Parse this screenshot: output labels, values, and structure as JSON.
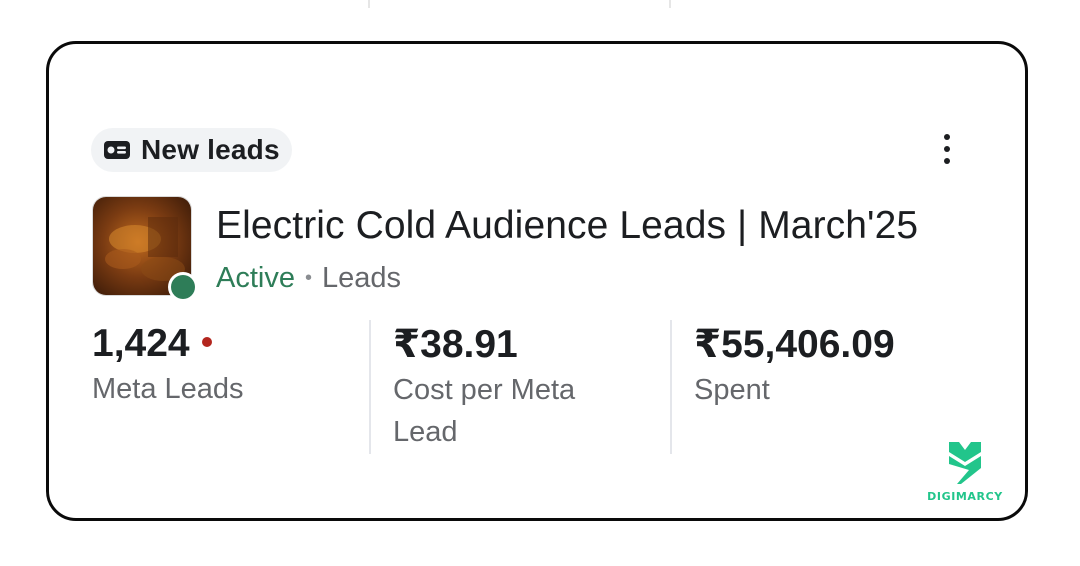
{
  "card": {
    "chip": {
      "icon": "id-card-icon",
      "label": "New leads"
    },
    "menu_icon": "more-vertical-icon",
    "campaign": {
      "title": "Electric Cold Audience Leads | March'25",
      "status": "Active",
      "separator": "•",
      "kind": "Leads",
      "status_color": "#2e7d58"
    },
    "metrics": [
      {
        "value": "1,424",
        "label": "Meta Leads",
        "alert_color": "#b3261e"
      },
      {
        "value": "₹38.91",
        "label": "Cost per Meta Lead"
      },
      {
        "value": "₹55,406.09",
        "label": "Spent"
      }
    ]
  },
  "watermark": {
    "text": "DIGIMARCY",
    "color": "#22c58b"
  }
}
